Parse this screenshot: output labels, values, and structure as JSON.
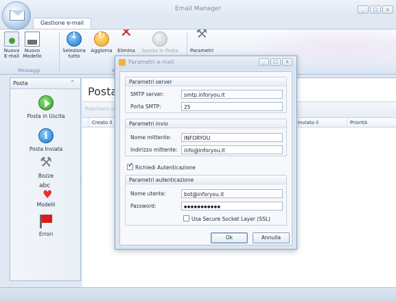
{
  "window": {
    "title": "Email Manager",
    "buttons": [
      "_",
      "□",
      "x"
    ]
  },
  "ribbon": {
    "tab": "Gestione e-mail",
    "buttons": [
      {
        "line1": "Nuova",
        "line2": "E-mail",
        "icon": "new-email-icon"
      },
      {
        "line1": "Nuovo",
        "line2": "Modello",
        "icon": "new-template-icon"
      },
      {
        "line1": "Seleziona",
        "line2": "tutto",
        "icon": "select-all-icon"
      },
      {
        "line1": "Aggiorna",
        "line2": "",
        "icon": "refresh-icon"
      },
      {
        "line1": "Elimina",
        "line2": "",
        "icon": "delete-icon"
      },
      {
        "line1": "Sposta in Posta",
        "line2": "",
        "icon": "move-icon"
      },
      {
        "line1": "Parametri",
        "line2": "",
        "icon": "settings-icon"
      }
    ],
    "group_messaggi": "Messaggi",
    "group_azioni": "Az"
  },
  "nav": {
    "header": "Posta",
    "items": [
      {
        "label": "Posta in Uscita",
        "icon": "outbox-icon"
      },
      {
        "label": "Posta Inviata",
        "icon": "sent-icon"
      },
      {
        "label": "Bozze",
        "icon": "drafts-icon"
      },
      {
        "label": "Modelli",
        "icon": "templates-icon",
        "icon_text": "abc"
      },
      {
        "label": "Errori",
        "icon": "errors-flag-icon"
      }
    ]
  },
  "content": {
    "title": "Posta",
    "filter_hint": "Trascinare un",
    "columns": [
      "Creato il",
      "Inviato il",
      "Priorità"
    ]
  },
  "dialog": {
    "title": "Parametri e-mail",
    "server": {
      "legend": "Parametri server",
      "smtp_label": "SMTP server:",
      "smtp_value": "smtp.inforyou.it",
      "port_label": "Porta SMTP:",
      "port_value": "25"
    },
    "sender": {
      "legend": "Parametri invio",
      "name_label": "Nome mittente:",
      "name_value": "INFORYOU",
      "address_label": "Indirizzo mittente:",
      "address_value": "info@inforyou.it"
    },
    "auth_checkbox": {
      "label": "Richiedi Autenticazione",
      "checked": true
    },
    "auth": {
      "legend": "Parametri autenticazione",
      "user_label": "Nome utente:",
      "user_value": "bot@inforyou.it",
      "password_label": "Password:",
      "password_value": "●●●●●●●●●●●",
      "ssl_label": "Usa Secure Socket Layer (SSL)",
      "ssl_checked": false
    },
    "ok_label": "Ok",
    "cancel_label": "Annulla"
  }
}
